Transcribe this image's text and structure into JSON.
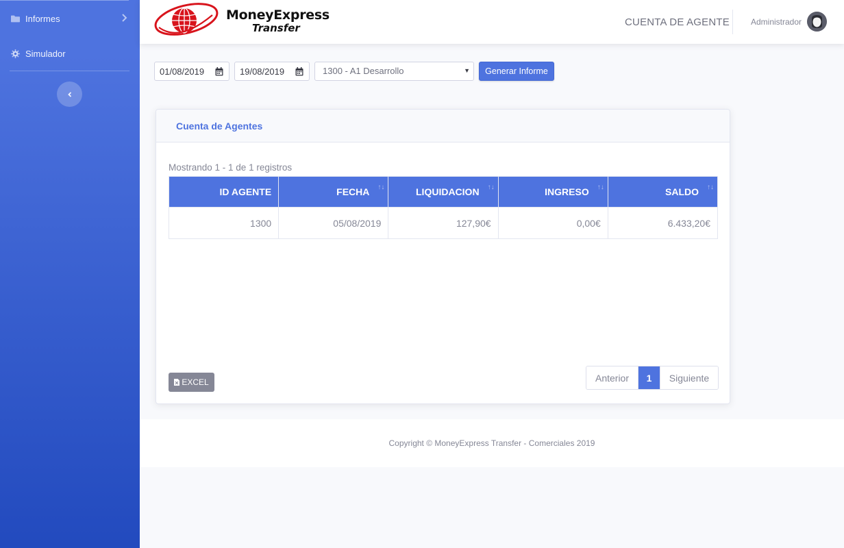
{
  "sidebar": {
    "items": [
      {
        "label": "Informes",
        "icon": "folder-icon"
      },
      {
        "label": "Simulador",
        "icon": "gear-icon"
      }
    ],
    "toggle_icon": "chevron-left-icon"
  },
  "header": {
    "logo_line1": "MoneyExpress",
    "logo_line2": "Transfer",
    "title": "CUENTA DE AGENTE",
    "user": "Administrador"
  },
  "filters": {
    "date_from": "01/08/2019",
    "date_to": "19/08/2019",
    "agent_selected": "1300 - A1 Desarrollo",
    "generate_label": "Generar Informe"
  },
  "card": {
    "title": "Cuenta de Agentes",
    "showing": "Mostrando 1 - 1 de 1 registros",
    "columns": [
      "ID AGENTE",
      "FECHA",
      "LIQUIDACION",
      "INGRESO",
      "SALDO"
    ],
    "rows": [
      [
        "1300",
        "05/08/2019",
        "127,90€",
        "0,00€",
        "6.433,20€"
      ]
    ],
    "excel_label": "EXCEL",
    "pager": {
      "prev": "Anterior",
      "current": "1",
      "next": "Siguiente"
    }
  },
  "footer": {
    "copyright": "Copyright © MoneyExpress Transfer - Comerciales 2019"
  },
  "colors": {
    "primary": "#4e73df",
    "sidebar_end": "#224abe",
    "logo_red": "#d8141c",
    "text_muted": "#858796"
  }
}
